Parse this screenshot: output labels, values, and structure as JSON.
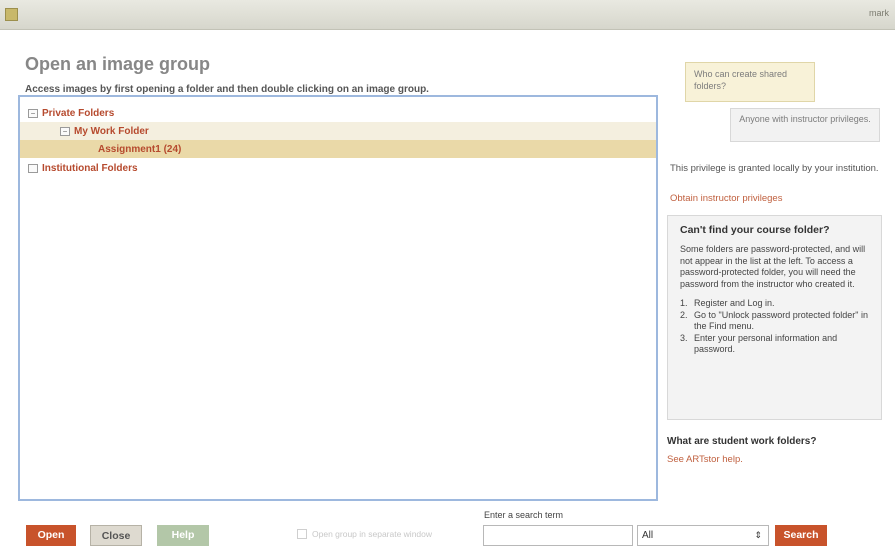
{
  "topbar": {
    "right_text": "mark"
  },
  "title": "Open an image group",
  "subtitle": "Access images by first opening a folder and then double clicking on an image group.",
  "tree": [
    {
      "label": "Private Folders",
      "toggle": "−"
    },
    {
      "label": "My Work Folder",
      "toggle": "−"
    },
    {
      "label": "Assignment1 (24)"
    },
    {
      "label": "Institutional Folders"
    }
  ],
  "tips": {
    "question": "Who can create shared folders?",
    "answer": "Anyone with instructor privileges."
  },
  "privilege_text": "This privilege is granted locally by your institution.",
  "privilege_link": "Obtain instructor privileges",
  "help_box": {
    "title": "Can't find your course folder?",
    "body": "Some folders are password-protected, and will not appear in the list at the left. To access a password-protected folder, you will need the password from the instructor who created it.",
    "steps": [
      {
        "num": "1.",
        "text": "Register and Log in."
      },
      {
        "num": "2.",
        "text": "Go to \"Unlock password protected folder\" in the Find menu."
      },
      {
        "num": "3.",
        "text": "Enter your personal information and password."
      }
    ]
  },
  "student": {
    "title": "What are student work folders?",
    "link": "See ARTstor help."
  },
  "buttons": {
    "open": "Open",
    "close": "Close",
    "help": "Help",
    "search": "Search"
  },
  "separate_window_label": "Open group in separate window",
  "search": {
    "label": "Enter a search term",
    "value": "",
    "scope": "All"
  },
  "icons": {
    "app": "app-icon",
    "folder_toggle": "minus-box-icon",
    "select_arrows": "updown-arrows-icon"
  },
  "colors": {
    "accent": "#c8532b",
    "link": "#c0603f",
    "tree_text": "#b64a2e",
    "panel_border": "#9db8de"
  }
}
